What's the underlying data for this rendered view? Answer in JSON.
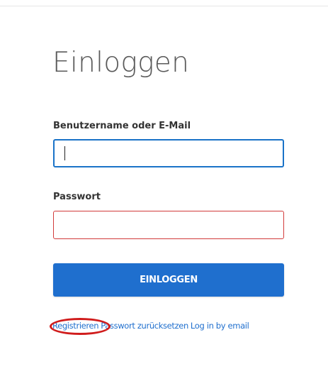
{
  "login_form": {
    "title": "Einloggen",
    "username_label": "Benutzername oder E-Mail",
    "username_value": "",
    "password_label": "Passwort",
    "password_value": "",
    "submit_label": "EINLOGGEN"
  },
  "links": {
    "register": "Registrieren",
    "reset_password": "Passwort zurücksetzen",
    "login_by_email": "Log in by email"
  },
  "colors": {
    "primary": "#1f6fce",
    "focus_border": "#1a73c8",
    "error_border": "#d23b3b",
    "annotation": "#d01c1c"
  }
}
